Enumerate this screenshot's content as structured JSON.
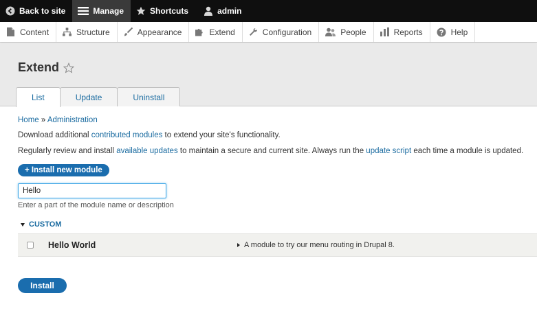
{
  "toolbar": {
    "back_label": "Back to site",
    "manage_label": "Manage",
    "shortcuts_label": "Shortcuts",
    "user_label": "admin"
  },
  "tray": {
    "items": [
      {
        "label": "Content",
        "icon": "document-icon"
      },
      {
        "label": "Structure",
        "icon": "structure-icon"
      },
      {
        "label": "Appearance",
        "icon": "paintbrush-icon"
      },
      {
        "label": "Extend",
        "icon": "puzzle-icon"
      },
      {
        "label": "Configuration",
        "icon": "wrench-icon"
      },
      {
        "label": "People",
        "icon": "people-icon"
      },
      {
        "label": "Reports",
        "icon": "bar-chart-icon"
      },
      {
        "label": "Help",
        "icon": "help-icon"
      }
    ]
  },
  "page": {
    "title": "Extend",
    "tabs": [
      {
        "label": "List",
        "active": true
      },
      {
        "label": "Update",
        "active": false
      },
      {
        "label": "Uninstall",
        "active": false
      }
    ]
  },
  "breadcrumb": {
    "home": "Home",
    "separator": "»",
    "admin": "Administration"
  },
  "intro": {
    "p1_before": "Download additional ",
    "p1_link": "contributed modules",
    "p1_after": " to extend your site's functionality.",
    "p2_before": "Regularly review and install ",
    "p2_link1": "available updates",
    "p2_mid": " to maintain a secure and current site. Always run the ",
    "p2_link2": "update script",
    "p2_after": " each time a module is updated."
  },
  "install_new_label": "+ Install new module",
  "filter": {
    "value": "Hello",
    "description": "Enter a part of the module name or description"
  },
  "group": {
    "label": "CUSTOM"
  },
  "modules": [
    {
      "name": "Hello World",
      "description": "A module to try our menu routing in Drupal 8."
    }
  ],
  "install_label": "Install",
  "colors": {
    "accent": "#1a6dae",
    "link": "#1a6ba0",
    "toolbar": "#0f0f0f"
  }
}
